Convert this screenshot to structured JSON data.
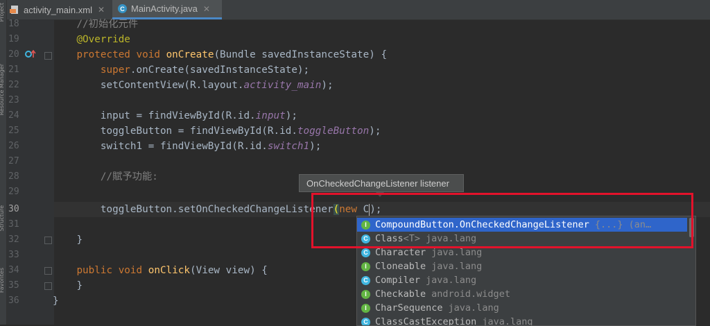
{
  "side_panel": {
    "labels": [
      "Project",
      "Resource Manager",
      "Structure",
      "Favorites"
    ]
  },
  "tabs": [
    {
      "label": "activity_main.xml",
      "icon": "xml-file-icon",
      "active": false
    },
    {
      "label": "MainActivity.java",
      "icon": "class-c-icon",
      "active": true
    }
  ],
  "editor": {
    "line_numbers": [
      "18",
      "19",
      "20",
      "21",
      "22",
      "23",
      "24",
      "25",
      "26",
      "27",
      "28",
      "29",
      "30",
      "31",
      "32",
      "33",
      "34",
      "35",
      "36"
    ],
    "lines": {
      "l18": "//初始化元件",
      "l19": "@Override",
      "l20_kw": "protected void ",
      "l20_fn": "onCreate",
      "l20_rest": "(Bundle savedInstanceState) {",
      "l21_kw": "super",
      "l21_rest": ".onCreate(savedInstanceState);",
      "l22_a": "setContentView(R.layout.",
      "l22_b": "activity_main",
      "l22_c": ");",
      "l24_a": "input = findViewById(R.id.",
      "l24_b": "input",
      "l24_c": ");",
      "l25_a": "toggleButton = findViewById(R.id.",
      "l25_b": "toggleButton",
      "l25_c": ");",
      "l26_a": "switch1 = findViewById(R.id.",
      "l26_b": "switch1",
      "l26_c": ");",
      "l28": "//賦予功能:",
      "l30_a": "toggleButton.setOnCheckedChangeListener",
      "l30_paren": "(",
      "l30_kw": "new",
      "l30_c": " C",
      "l30_end": ");",
      "l32": "}",
      "l34_kw": "public void ",
      "l34_fn": "onClick",
      "l34_rest": "(View view) {",
      "l35": "}",
      "l36": "}"
    }
  },
  "tooltip": {
    "text": "OnCheckedChangeListener listener"
  },
  "completion": {
    "items": [
      {
        "icon": "I",
        "kind": "interface",
        "name": "CompoundButton.OnCheckedChangeListener",
        "detail": "{...} (an…",
        "selected": true
      },
      {
        "icon": "C",
        "kind": "class",
        "name": "Class",
        "generic": "<T>",
        "detail": "java.lang",
        "selected": false
      },
      {
        "icon": "C",
        "kind": "class",
        "name": "Character",
        "detail": "java.lang",
        "selected": false
      },
      {
        "icon": "I",
        "kind": "interface",
        "name": "Cloneable",
        "detail": "java.lang",
        "selected": false
      },
      {
        "icon": "C",
        "kind": "class",
        "name": "Compiler",
        "detail": "java.lang",
        "selected": false
      },
      {
        "icon": "I",
        "kind": "interface",
        "name": "Checkable",
        "detail": "android.widget",
        "selected": false
      },
      {
        "icon": "I",
        "kind": "interface",
        "name": "CharSequence",
        "detail": "java.lang",
        "selected": false
      },
      {
        "icon": "C",
        "kind": "class",
        "name": "ClassCastException",
        "detail": "java.lang",
        "selected": false
      }
    ]
  },
  "colors": {
    "editor_bg": "#2b2b2b",
    "keyword": "#cc7832",
    "method": "#ffc66d",
    "annotation": "#bbb529",
    "field": "#9876aa",
    "selection": "#2f65ca",
    "highlight_box": "#e3122b"
  }
}
